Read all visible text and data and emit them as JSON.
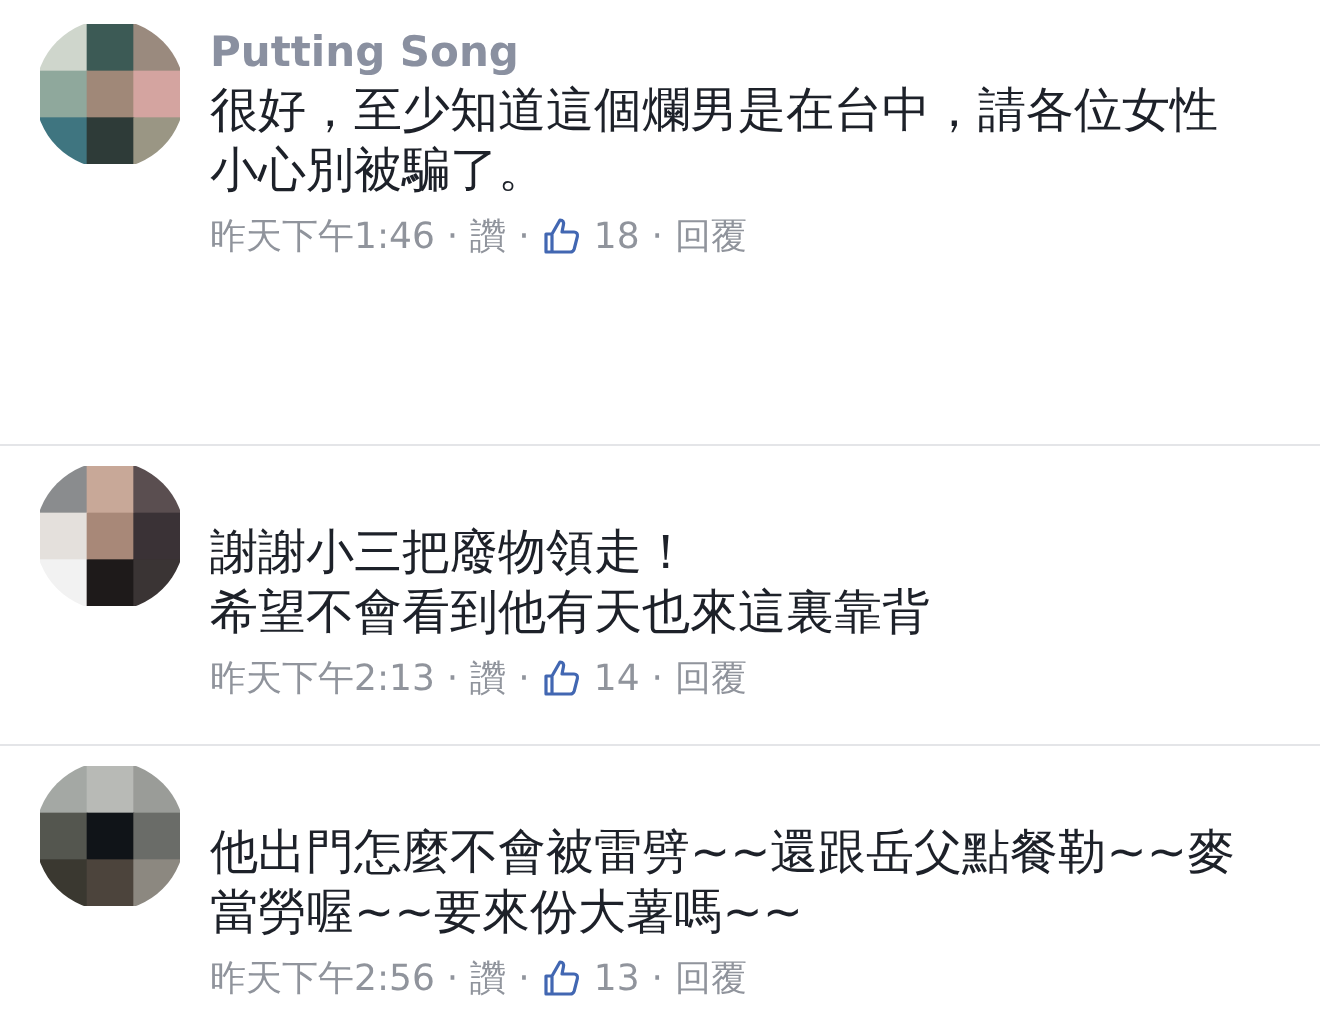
{
  "comments": [
    {
      "author": "Putting Song",
      "lines": [
        "很好，至少知道這個爛男是在台中，請各位女性",
        "小心別被騙了。"
      ],
      "time": "昨天下午1:46",
      "separators": [
        "·",
        "·",
        "·"
      ],
      "like_link": "讚",
      "likes": "18",
      "reply_link": "回覆"
    },
    {
      "lines": [
        "謝謝小三把廢物領走！",
        "希望不會看到他有天也來這裏靠背"
      ],
      "time": "昨天下午2:13",
      "separators": [
        "·",
        "·",
        "·"
      ],
      "like_link": "讚",
      "likes": "14",
      "reply_link": "回覆"
    },
    {
      "lines": [
        "他出門怎麼不會被雷劈~~還跟岳父點餐勒~~麥",
        "當勞喔~~要來份大薯嗎~~"
      ],
      "time": "昨天下午2:56",
      "separators": [
        "·",
        "·",
        "·"
      ],
      "like_link": "讚",
      "likes": "13",
      "reply_link": "回覆"
    }
  ]
}
